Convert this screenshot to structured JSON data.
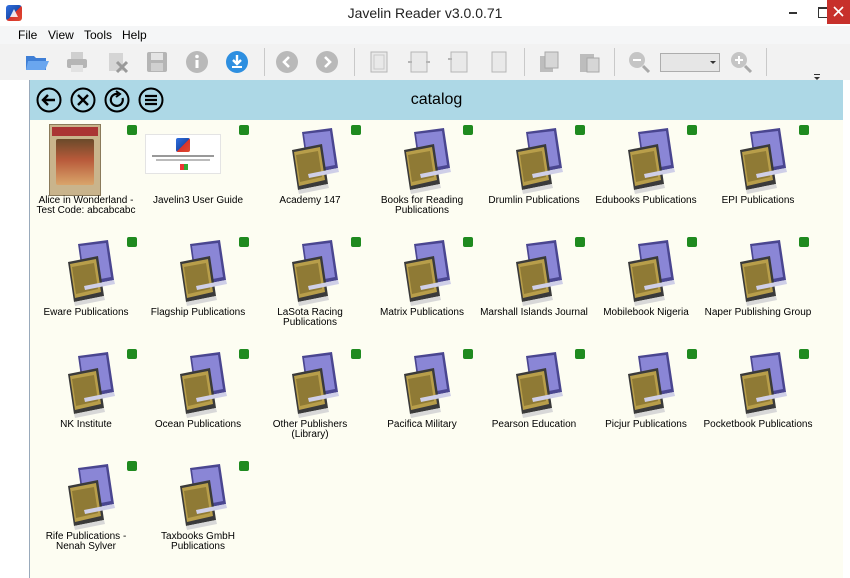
{
  "window": {
    "title": "Javelin Reader v3.0.0.71"
  },
  "menu": [
    "File",
    "View",
    "Tools",
    "Help"
  ],
  "toolbar": {
    "icons": [
      "open-folder-icon",
      "print-icon",
      "delete-icon",
      "save-icon",
      "info-icon",
      "download-icon",
      "back-icon",
      "forward-icon",
      "page-fit-icon",
      "page-width-icon",
      "rotate-left-icon",
      "rotate-right-icon",
      "copy-icon",
      "paste-icon",
      "zoom-out-icon",
      "zoom-in-icon"
    ],
    "zoom_value": ""
  },
  "catalog": {
    "title": "catalog",
    "items": [
      {
        "label": "Alice in Wonderland - Test Code: abcabcabc",
        "thumb": "alice-cover"
      },
      {
        "label": "Javelin3 User Guide",
        "thumb": "guide-cover"
      },
      {
        "label": "Academy 147",
        "thumb": "books-icon"
      },
      {
        "label": "Books for Reading Publications",
        "thumb": "books-icon"
      },
      {
        "label": "Drumlin Publications",
        "thumb": "books-icon"
      },
      {
        "label": "Edubooks Publications",
        "thumb": "books-icon"
      },
      {
        "label": "EPI Publications",
        "thumb": "books-icon"
      },
      {
        "label": "Eware Publications",
        "thumb": "books-icon"
      },
      {
        "label": "Flagship Publications",
        "thumb": "books-icon"
      },
      {
        "label": "LaSota Racing Publications",
        "thumb": "books-icon"
      },
      {
        "label": "Matrix Publications",
        "thumb": "books-icon"
      },
      {
        "label": "Marshall Islands Journal",
        "thumb": "books-icon"
      },
      {
        "label": "Mobilebook Nigeria",
        "thumb": "books-icon"
      },
      {
        "label": "Naper Publishing Group",
        "thumb": "books-icon"
      },
      {
        "label": "NK Institute",
        "thumb": "books-icon"
      },
      {
        "label": "Ocean Publications",
        "thumb": "books-icon"
      },
      {
        "label": "Other Publishers (Library)",
        "thumb": "books-icon"
      },
      {
        "label": "Pacifica Military",
        "thumb": "books-icon"
      },
      {
        "label": "Pearson Education",
        "thumb": "books-icon"
      },
      {
        "label": "Picjur Publications",
        "thumb": "books-icon"
      },
      {
        "label": "Pocketbook Publications",
        "thumb": "books-icon"
      },
      {
        "label": "Rife Publications - Nenah Sylver",
        "thumb": "books-icon"
      },
      {
        "label": "Taxbooks GmbH Publications",
        "thumb": "books-icon"
      }
    ]
  },
  "colors": {
    "nav_bar": "#add8e6",
    "content_bg": "#fdfdf2",
    "status_dot": "#1f8a1f",
    "book_purple": "#7d78c8",
    "book_gold": "#b89e4a"
  }
}
